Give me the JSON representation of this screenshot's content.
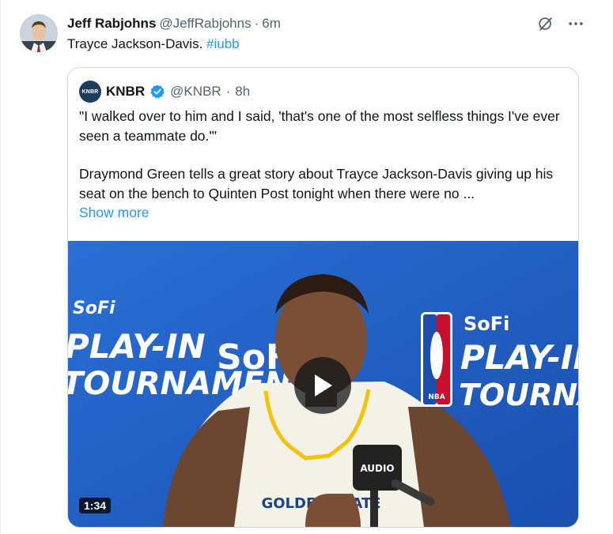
{
  "author": {
    "name": "Jeff Rabjohns",
    "handle": "@JeffRabjohns",
    "separator": "·",
    "time": "6m"
  },
  "tweet": {
    "text": "Trayce Jackson-Davis. ",
    "hashtag": "#iubb"
  },
  "actions": {
    "grok_icon": "grok-icon",
    "more_icon": "more-icon"
  },
  "quote": {
    "logo_text": "KNBR",
    "name": "KNBR",
    "handle": "@KNBR",
    "separator": "·",
    "time": "8h",
    "paragraph1": "\"I walked over to him and I said, 'that's one of the most selfless things I've ever seen a teammate do.'\"",
    "paragraph2": "Draymond Green tells a great story about Trayce Jackson-Davis giving up his seat on the bench to Quinten Post tonight when there were no ...",
    "show_more": "Show more"
  },
  "video": {
    "duration": "1:34",
    "sign_left_1": "SoFi",
    "sign_left_2": "PLAY-IN",
    "sign_left_3": "TOURNAMENT",
    "sign_mid": "SoFi",
    "sign_right_1": "SoFi",
    "sign_right_2": "PLAY-IN",
    "sign_right_3": "TOURNAMENT",
    "nba_text": "NBA",
    "jersey_text": "GOLDEN STATE",
    "mic_text": "AUDIO"
  },
  "colors": {
    "accent": "#1d9bf0",
    "text": "#0f1419",
    "muted": "#536471",
    "border": "#cfd9de",
    "backdrop": "#1f5fc4"
  }
}
